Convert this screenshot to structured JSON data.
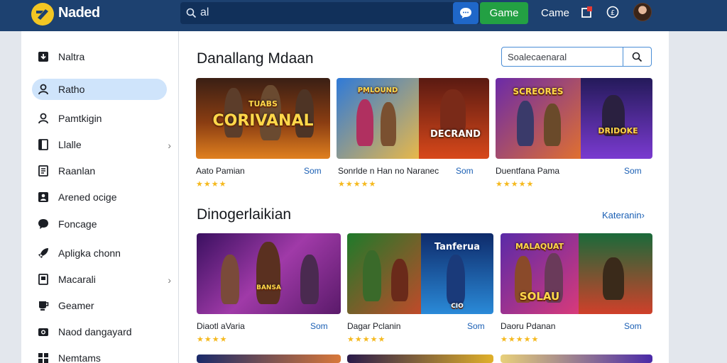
{
  "header": {
    "logo_text": "Naded",
    "search_value": "al",
    "game_button": "Game",
    "link": "Came"
  },
  "sidebar": {
    "items": [
      {
        "label": "Naltra",
        "icon": "download-icon"
      },
      {
        "label": "Ratho",
        "icon": "user-icon",
        "active": true
      },
      {
        "label": "Pamtkigin",
        "icon": "person-icon"
      },
      {
        "label": "Llalle",
        "icon": "tablet-icon",
        "chevron": true
      },
      {
        "label": "Raanlan",
        "icon": "list-icon"
      },
      {
        "label": "Arened ocige",
        "icon": "profile-icon"
      },
      {
        "label": "Foncage",
        "icon": "chat-icon"
      },
      {
        "label": "Apligka chonn",
        "icon": "rocket-icon"
      },
      {
        "label": "Macarali",
        "icon": "book-icon",
        "chevron": true
      },
      {
        "label": "Geamer",
        "icon": "cup-icon"
      },
      {
        "label": "Naod dangayard",
        "icon": "camera-icon"
      },
      {
        "label": "Nemtams",
        "icon": "grid-icon"
      }
    ]
  },
  "section1": {
    "title": "Danallang Mdaan",
    "filter_placeholder": "Soalecaenaral",
    "cards": [
      {
        "title": "Aato Pamian",
        "action": "Som",
        "rating": 4,
        "thumb_text": "CORIVANAL",
        "thumb_top": "TUABS"
      },
      {
        "title": "Sonrlde n Han no Naranec",
        "action": "Som",
        "rating": 4.5,
        "thumb_text": "DECRAND",
        "thumb_top": "PMLOUND"
      },
      {
        "title": "Duentfana Pama",
        "action": "Som",
        "rating": 5,
        "thumb_text": "DRIDOKE",
        "thumb_top": "SCREORES"
      }
    ]
  },
  "section2": {
    "title": "Dinogerlaikian",
    "more_link": "Kateranin›",
    "cards": [
      {
        "title": "Diaotl aVaria",
        "action": "Som",
        "rating": 4,
        "thumb_text": "BANSA",
        "thumb_top": ""
      },
      {
        "title": "Dagar Pclanin",
        "action": "Som",
        "rating": 5,
        "thumb_text": "CIO",
        "thumb_top": "Tanferua"
      },
      {
        "title": "Daoru Pdanan",
        "action": "Som",
        "rating": 5,
        "thumb_text": "SOLAU",
        "thumb_top": "MALAQUAT"
      }
    ]
  },
  "colors": {
    "topbar": "#1d4170",
    "accent": "#1a5fb4",
    "active_item": "#cfe4fb",
    "game_button": "#23a043",
    "star": "#f5b91e"
  }
}
